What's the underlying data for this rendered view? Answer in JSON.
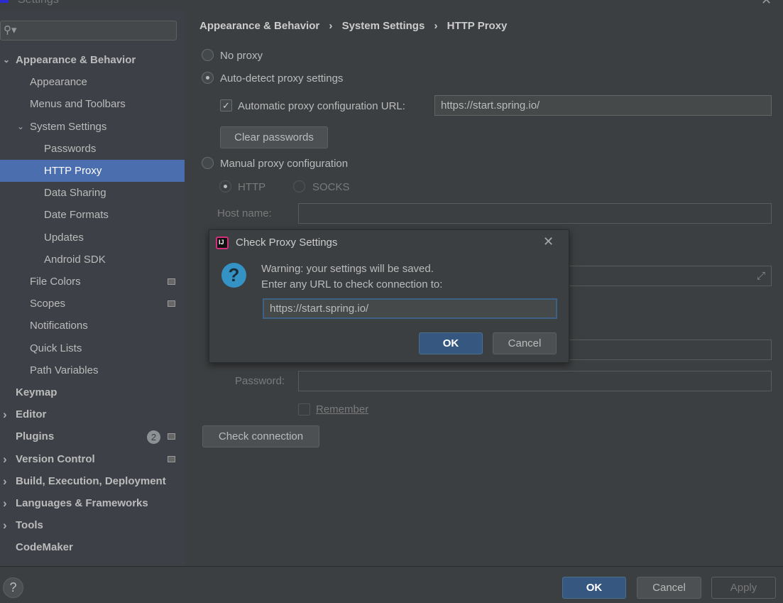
{
  "window": {
    "title": "Settings",
    "close_icon": "close-icon"
  },
  "sidebar": {
    "search_placeholder": "",
    "items": [
      {
        "label": "Appearance & Behavior",
        "level": 0,
        "bold": true,
        "expanded": true
      },
      {
        "label": "Appearance",
        "level": 1
      },
      {
        "label": "Menus and Toolbars",
        "level": 1
      },
      {
        "label": "System Settings",
        "level": 1,
        "expanded": true
      },
      {
        "label": "Passwords",
        "level": 2
      },
      {
        "label": "HTTP Proxy",
        "level": 2,
        "selected": true
      },
      {
        "label": "Data Sharing",
        "level": 2
      },
      {
        "label": "Date Formats",
        "level": 2
      },
      {
        "label": "Updates",
        "level": 2
      },
      {
        "label": "Android SDK",
        "level": 2
      },
      {
        "label": "File Colors",
        "level": 1,
        "project_icon": true
      },
      {
        "label": "Scopes",
        "level": 1,
        "project_icon": true
      },
      {
        "label": "Notifications",
        "level": 1
      },
      {
        "label": "Quick Lists",
        "level": 1
      },
      {
        "label": "Path Variables",
        "level": 1
      },
      {
        "label": "Keymap",
        "level": 0,
        "bold": true
      },
      {
        "label": "Editor",
        "level": 0,
        "bold": true,
        "collapsed": true
      },
      {
        "label": "Plugins",
        "level": 0,
        "bold": true,
        "badge": "2",
        "project_icon": true
      },
      {
        "label": "Version Control",
        "level": 0,
        "bold": true,
        "collapsed": true,
        "project_icon": true
      },
      {
        "label": "Build, Execution, Deployment",
        "level": 0,
        "bold": true,
        "collapsed": true
      },
      {
        "label": "Languages & Frameworks",
        "level": 0,
        "bold": true,
        "collapsed": true
      },
      {
        "label": "Tools",
        "level": 0,
        "bold": true,
        "collapsed": true
      },
      {
        "label": "CodeMaker",
        "level": 0,
        "bold": true
      }
    ]
  },
  "breadcrumb": [
    "Appearance & Behavior",
    "System Settings",
    "HTTP Proxy"
  ],
  "proxy": {
    "no_proxy": "No proxy",
    "auto_detect": "Auto-detect proxy settings",
    "auto_url_label": "Automatic proxy configuration URL:",
    "auto_url_checked": true,
    "auto_url_value": "https://start.spring.io/",
    "clear_passwords": "Clear passwords",
    "manual": "Manual proxy configuration",
    "http": "HTTP",
    "socks": "SOCKS",
    "host_label": "Host name:",
    "password_label": "Password:",
    "remember": "Remember",
    "check_connection": "Check connection",
    "selected": "auto_detect"
  },
  "dialog": {
    "title": "Check Proxy Settings",
    "line1": "Warning: your settings will be saved.",
    "line2": "Enter any URL to check connection to:",
    "url": "https://start.spring.io/",
    "ok": "OK",
    "cancel": "Cancel"
  },
  "footer": {
    "help": "?",
    "ok": "OK",
    "cancel": "Cancel",
    "apply": "Apply"
  }
}
